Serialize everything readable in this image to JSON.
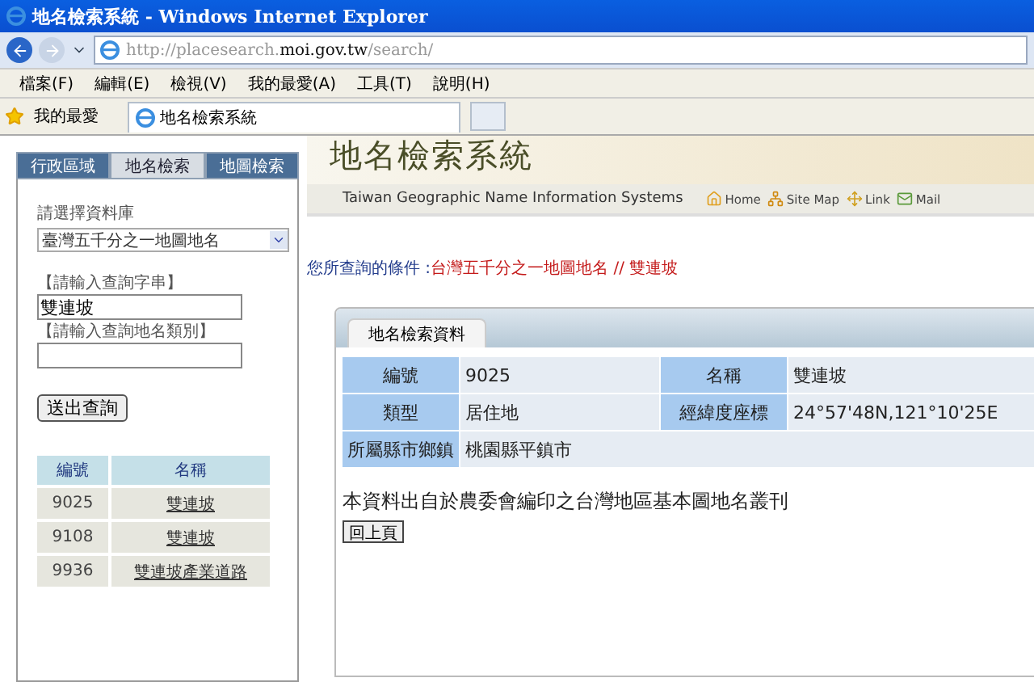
{
  "window": {
    "title": "地名檢索系統 - Windows Internet Explorer"
  },
  "address_bar": {
    "url_prefix": "http://placesearch.",
    "url_domain": "moi.gov.tw",
    "url_suffix": "/search/"
  },
  "menu_bar": [
    "檔案(F)",
    "編輯(E)",
    "檢視(V)",
    "我的最愛(A)",
    "工具(T)",
    "說明(H)"
  ],
  "favorites_bar": {
    "favorites": "我的最愛",
    "tabs": [
      {
        "label": "地名檢索系統",
        "selected": true
      }
    ]
  },
  "sidebar": {
    "tabs": [
      {
        "label": "行政區域",
        "selected": false
      },
      {
        "label": "地名檢索",
        "selected": true
      },
      {
        "label": "地圖檢索",
        "selected": false
      }
    ],
    "database_label": "請選擇資料庫",
    "database_value": "臺灣五千分之一地圖地名",
    "query_label": "【請輸入查詢字串】",
    "query_value": "雙連坡",
    "category_label": "【請輸入查詢地名類別】",
    "submit": "送出查詢",
    "results": {
      "columns": [
        "編號",
        "名稱"
      ],
      "rows": [
        {
          "id": "9025",
          "name": "雙連坡"
        },
        {
          "id": "9108",
          "name": "雙連坡"
        },
        {
          "id": "9936",
          "name": "雙連坡產業道路"
        }
      ]
    }
  },
  "header": {
    "title": "地名檢索系統",
    "subtitle": "Taiwan Geographic Name Information Systems",
    "links": [
      {
        "kind": "home",
        "label": "Home"
      },
      {
        "kind": "sitemap",
        "label": "Site Map"
      },
      {
        "kind": "link",
        "label": "Link"
      },
      {
        "kind": "mail",
        "label": "Mail"
      }
    ]
  },
  "query_summary": {
    "label": "您所查詢的條件 :",
    "value": "台灣五千分之一地圖地名 // 雙連坡"
  },
  "detail": {
    "tab": "地名檢索資料",
    "rows": [
      [
        {
          "label": "編號",
          "value": "9025"
        },
        {
          "label": "名稱",
          "value": "雙連坡"
        }
      ],
      [
        {
          "label": "類型",
          "value": "居住地"
        },
        {
          "label": "經緯度座標",
          "value": "24°57'48N,121°10'25E"
        }
      ],
      [
        {
          "label": "所屬縣市鄉鎮",
          "value": "桃園縣平鎮市"
        }
      ]
    ],
    "note": "本資料出自於農委會編印之台灣地區基本圖地名叢刊",
    "back_button": "回上頁"
  }
}
